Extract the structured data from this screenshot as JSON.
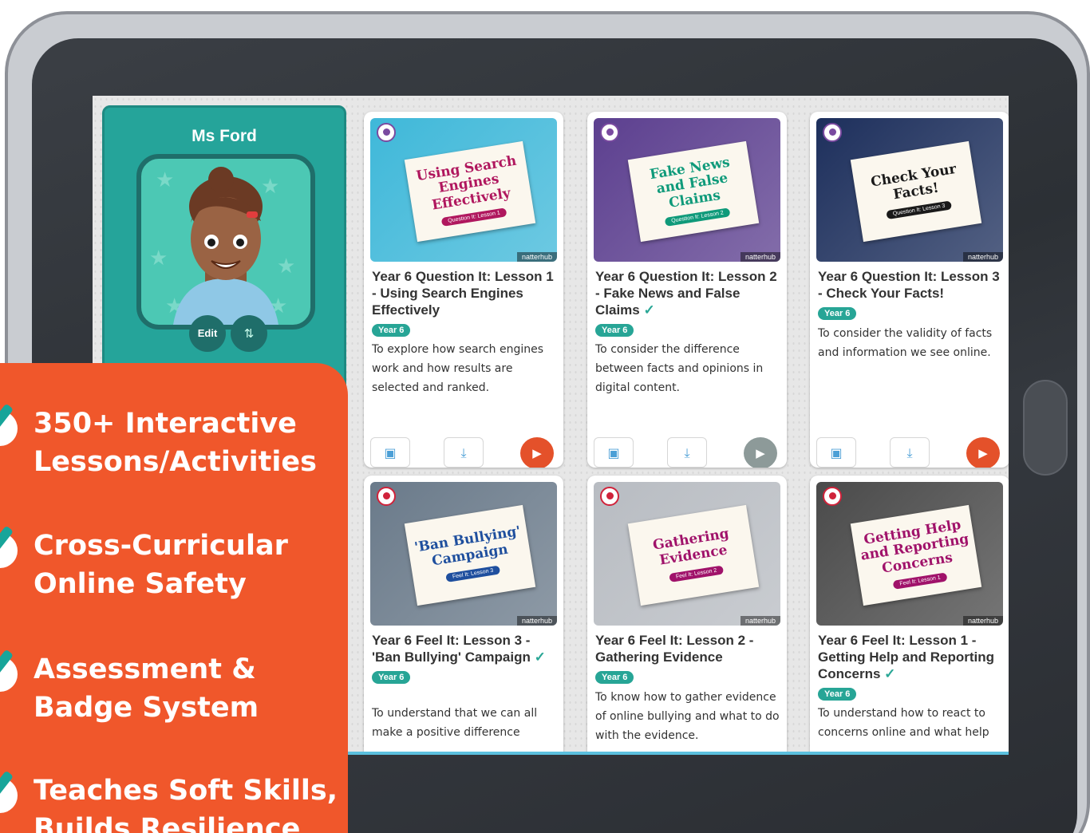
{
  "profile": {
    "teacher_name": "Ms Ford",
    "edit_label": "Edit",
    "reorder_icon": "⇅"
  },
  "cards": [
    {
      "sign_title": "Using Search Engines Effectively",
      "sign_tag": "Question It: Lesson 1",
      "brand": "natterhub",
      "title": "Year 6 Question It: Lesson 1 - Using Search Engines Effectively",
      "completed": false,
      "year": "Year 6",
      "description": "To explore how search engines work and how results are selected and ranked.",
      "play_state": "active",
      "corner": "question",
      "thumb_color": "#3fb8d9",
      "sign_color": "#b0175e"
    },
    {
      "sign_title": "Fake News and False Claims",
      "sign_tag": "Question It: Lesson 2",
      "brand": "natterhub",
      "title": "Year 6 Question It: Lesson 2 - Fake News and False Claims",
      "completed": true,
      "year": "Year 6",
      "description": "To consider the difference between facts and opinions in digital content.",
      "play_state": "completed",
      "corner": "question",
      "thumb_color": "#5c3f8f",
      "sign_color": "#0f9a7a"
    },
    {
      "sign_title": "Check Your Facts!",
      "sign_tag": "Question It: Lesson 3",
      "brand": "natterhub",
      "title": "Year 6 Question It: Lesson 3 - Check Your Facts!",
      "completed": false,
      "year": "Year 6",
      "description": "To consider the validity of facts and information we see online.",
      "play_state": "active",
      "corner": "question",
      "thumb_color": "#1d2f5c",
      "sign_color": "#1a1a1a"
    },
    {
      "sign_title": "'Ban Bullying' Campaign",
      "sign_tag": "Feel It: Lesson 3",
      "brand": "natterhub",
      "title": "Year 6 Feel It: Lesson 3 - 'Ban Bullying' Campaign",
      "completed": true,
      "year": "Year 6",
      "description": "To understand that we can all make a positive difference",
      "play_state": "active",
      "corner": "heart",
      "thumb_color": "#6a7a8a",
      "sign_color": "#1f4f9e"
    },
    {
      "sign_title": "Gathering Evidence",
      "sign_tag": "Feel It: Lesson 2",
      "brand": "natterhub",
      "title": "Year 6 Feel It: Lesson 2 - Gathering Evidence",
      "completed": false,
      "year": "Year 6",
      "description": "To know how to gather evidence of online bullying and what to do with the evidence.",
      "play_state": "active",
      "corner": "heart",
      "thumb_color": "#b8bcc2",
      "sign_color": "#a0126a"
    },
    {
      "sign_title": "Getting Help and Reporting Concerns",
      "sign_tag": "Feel It: Lesson 1",
      "brand": "natterhub",
      "title": "Year 6 Feel It: Lesson 1 - Getting Help and Reporting Concerns",
      "completed": true,
      "year": "Year 6",
      "description": "To understand how to react to concerns online and what help",
      "play_state": "active",
      "corner": "heart",
      "thumb_color": "#4a4a4a",
      "sign_color": "#a0126a"
    }
  ],
  "promo": [
    "350+ Interactive Lessons/Activities",
    "Cross-Curricular Online Safety",
    "Assessment & Badge System",
    "Teaches Soft Skills, Builds Resilience"
  ],
  "icons": {
    "resource": "resource-icon",
    "download": "download-icon",
    "play": "play-icon",
    "check": "check-icon"
  },
  "colors": {
    "brand_teal": "#25a49a",
    "promo_orange": "#f0572b",
    "play_orange": "#e4512a",
    "play_done": "#8d9a99"
  }
}
